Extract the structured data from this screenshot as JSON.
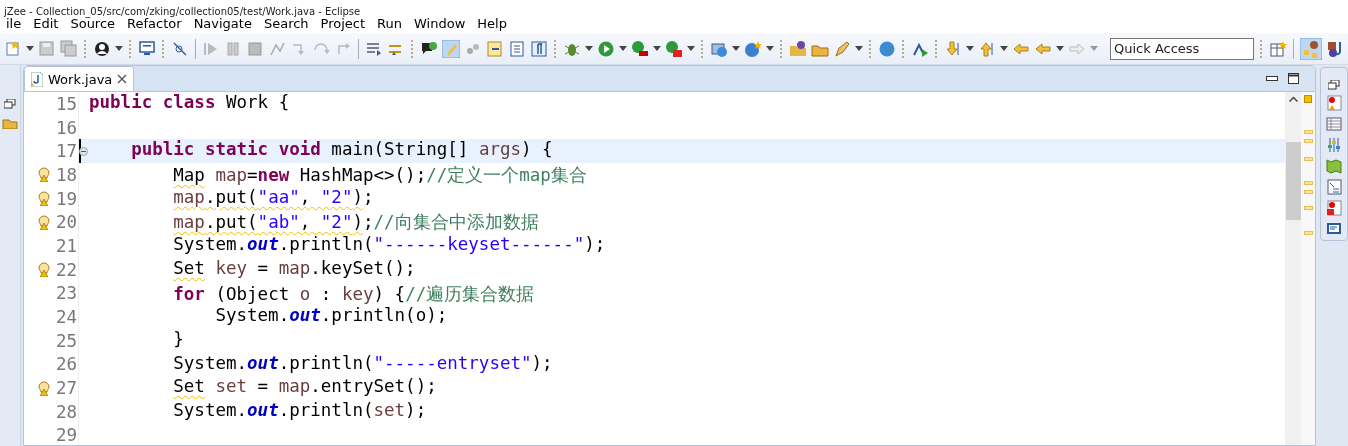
{
  "window": {
    "title": "jZee - Collection_05/src/com/zking/collection05/test/Work.java - Eclipse"
  },
  "menu": [
    "ile",
    "Edit",
    "Source",
    "Refactor",
    "Navigate",
    "Search",
    "Project",
    "Run",
    "Window",
    "Help"
  ],
  "quick_access": {
    "value": "Quick Access"
  },
  "tabs": [
    {
      "label": "Work.java",
      "selected": true
    }
  ],
  "editor": {
    "lines": [
      {
        "number": "15",
        "warning": false,
        "current": false,
        "fold": false,
        "tokens": [
          {
            "t": "public class",
            "kind": "keyword"
          },
          {
            "t": " Work {"
          }
        ]
      },
      {
        "number": "16",
        "warning": false,
        "current": false,
        "fold": false
      },
      {
        "number": "17",
        "warning": false,
        "current": true,
        "fold": true,
        "tokens": [
          {
            "t": "    public static void",
            "kind": "keyword"
          },
          {
            "t": " main(String[] "
          },
          {
            "t": "args",
            "kind": "variable"
          },
          {
            "t": ") {"
          }
        ]
      },
      {
        "number": "18",
        "warning": true,
        "current": false,
        "fold": false,
        "tokens": [
          {
            "t": "        Map",
            "squiggle": true
          },
          {
            "t": " map",
            "kind": "variable"
          },
          {
            "t": "="
          },
          {
            "t": "new",
            "kind": "keyword"
          },
          {
            "t": " HashMap<>();"
          },
          {
            "t": "//定义一个map集合",
            "kind": "comment"
          }
        ]
      },
      {
        "number": "19",
        "warning": true,
        "current": false,
        "fold": false,
        "tokens": [
          {
            "t": "        map",
            "kind": "variable",
            "squiggle": true
          },
          {
            "t": ".put(",
            "squiggle": true
          },
          {
            "t": "\"aa\"",
            "kind": "string",
            "squiggle": true
          },
          {
            "t": ", ",
            "squiggle": true
          },
          {
            "t": "\"2\"",
            "kind": "string",
            "squiggle": true
          },
          {
            "t": ")",
            "squiggle": true
          },
          {
            "t": ";"
          }
        ]
      },
      {
        "number": "20",
        "warning": true,
        "current": false,
        "fold": false,
        "tokens": [
          {
            "t": "        map",
            "kind": "variable",
            "squiggle": true
          },
          {
            "t": ".put(",
            "squiggle": true
          },
          {
            "t": "\"ab\"",
            "kind": "string",
            "squiggle": true
          },
          {
            "t": ", ",
            "squiggle": true
          },
          {
            "t": "\"2\"",
            "kind": "string",
            "squiggle": true
          },
          {
            "t": ")",
            "squiggle": true
          },
          {
            "t": ";"
          },
          {
            "t": "//向集合中添加数据",
            "kind": "comment"
          }
        ]
      },
      {
        "number": "21",
        "warning": false,
        "current": false,
        "fold": false,
        "tokens": [
          {
            "t": "        System."
          },
          {
            "t": "out",
            "kind": "field"
          },
          {
            "t": ".println("
          },
          {
            "t": "\"------keyset------\"",
            "kind": "string"
          },
          {
            "t": ");"
          }
        ]
      },
      {
        "number": "22",
        "warning": true,
        "current": false,
        "fold": false,
        "tokens": [
          {
            "t": "        Set",
            "squiggle": true
          },
          {
            "t": " key",
            "kind": "variable"
          },
          {
            "t": " = "
          },
          {
            "t": "map",
            "kind": "variable"
          },
          {
            "t": ".keySet();"
          }
        ]
      },
      {
        "number": "23",
        "warning": false,
        "current": false,
        "fold": false,
        "tokens": [
          {
            "t": "        for",
            "kind": "keyword"
          },
          {
            "t": " (Object "
          },
          {
            "t": "o",
            "kind": "variable"
          },
          {
            "t": " : "
          },
          {
            "t": "key",
            "kind": "variable"
          },
          {
            "t": ") {"
          },
          {
            "t": "//遍历集合数据",
            "kind": "comment"
          }
        ]
      },
      {
        "number": "24",
        "warning": false,
        "current": false,
        "fold": false,
        "tokens": [
          {
            "t": "            System."
          },
          {
            "t": "out",
            "kind": "field"
          },
          {
            "t": ".println(o);"
          }
        ]
      },
      {
        "number": "25",
        "warning": false,
        "current": false,
        "fold": false,
        "tokens": [
          {
            "t": "        }"
          }
        ]
      },
      {
        "number": "26",
        "warning": false,
        "current": false,
        "fold": false,
        "tokens": [
          {
            "t": "        System."
          },
          {
            "t": "out",
            "kind": "field"
          },
          {
            "t": ".println("
          },
          {
            "t": "\"-----entryset\"",
            "kind": "string"
          },
          {
            "t": ");"
          }
        ]
      },
      {
        "number": "27",
        "warning": true,
        "current": false,
        "fold": false,
        "tokens": [
          {
            "t": "        Set",
            "squiggle": true
          },
          {
            "t": " set",
            "kind": "variable"
          },
          {
            "t": " = "
          },
          {
            "t": "map",
            "kind": "variable"
          },
          {
            "t": ".entrySet();"
          }
        ]
      },
      {
        "number": "28",
        "warning": false,
        "current": false,
        "fold": false,
        "tokens": [
          {
            "t": "        System."
          },
          {
            "t": "out",
            "kind": "field"
          },
          {
            "t": ".println("
          },
          {
            "t": "set",
            "kind": "variable"
          },
          {
            "t": ");"
          }
        ]
      },
      {
        "number": "29",
        "warning": false,
        "current": false,
        "fold": false
      }
    ]
  }
}
